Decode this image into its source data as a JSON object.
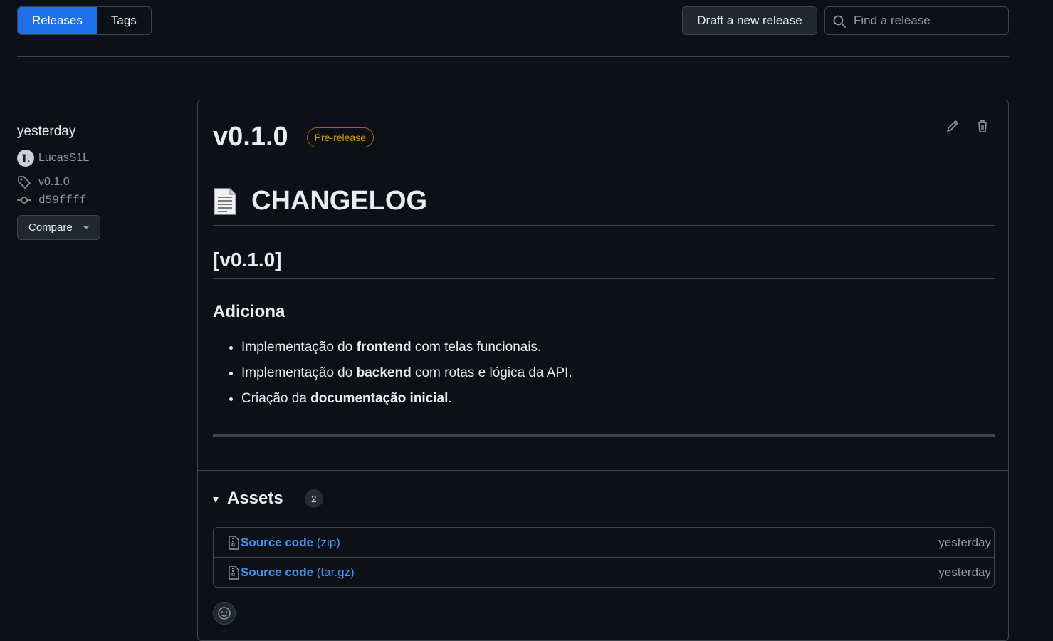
{
  "tabs": [
    {
      "label": "Releases",
      "active": true
    },
    {
      "label": "Tags",
      "active": false
    }
  ],
  "actions": {
    "draft_label": "Draft a new release"
  },
  "search": {
    "placeholder": "Find a release"
  },
  "sidebar": {
    "date": "yesterday",
    "author": "LucasS1L",
    "avatar_letter": "L",
    "tag": "v0.1.0",
    "commit": "d59ffff",
    "compare_label": "Compare"
  },
  "release": {
    "title": "v0.1.0",
    "badge": "Pre-release",
    "badge_color": "#d29922",
    "body": {
      "h1": "CHANGELOG",
      "h2": "[v0.1.0]",
      "h3": "Adiciona",
      "items": [
        {
          "pre": "Implementação do ",
          "bold": "frontend",
          "post": " com telas funcionais."
        },
        {
          "pre": "Implementação do ",
          "bold": "backend",
          "post": " com rotas e lógica da API."
        },
        {
          "pre": "Criação da ",
          "bold": "documentação inicial",
          "post": "."
        }
      ]
    }
  },
  "assets": {
    "label": "Assets",
    "count": "2",
    "items": [
      {
        "name": "Source code",
        "ext": "(zip)",
        "when": "yesterday"
      },
      {
        "name": "Source code",
        "ext": "(tar.gz)",
        "when": "yesterday"
      }
    ]
  },
  "colors": {
    "accent": "#1f6feb",
    "link": "#4493f8",
    "background": "#0d1117"
  }
}
